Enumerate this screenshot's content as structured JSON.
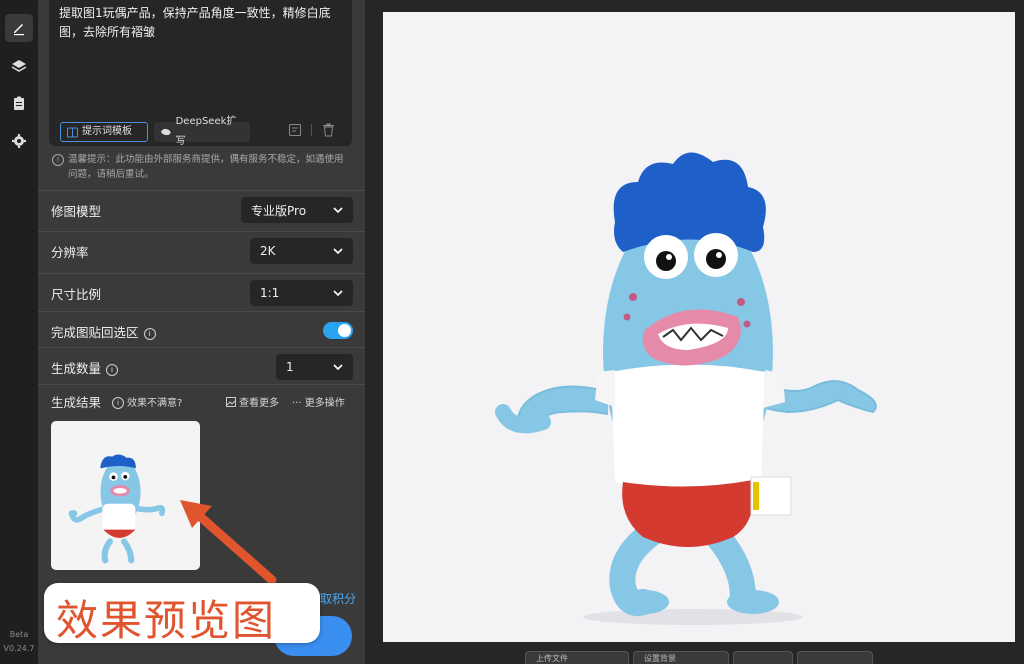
{
  "rail": {
    "items": [
      {
        "icon": "edit-icon"
      },
      {
        "icon": "layers-icon"
      },
      {
        "icon": "clipboard-icon"
      },
      {
        "icon": "gear-icon"
      }
    ],
    "beta": "Beta",
    "version": "V0.24.7"
  },
  "prompt": {
    "text": "提取图1玩偶产品，保持产品角度一致性，精修白底图，去除所有褶皱",
    "template_label": "提示词模板",
    "deepseek_label": "DeepSeek扩写"
  },
  "notice": {
    "text": "温馨提示：此功能由外部服务商提供，偶有服务不稳定，如遇使用问题，请稍后重试。"
  },
  "settings": {
    "model_label": "修图模型",
    "model_value": "专业版Pro",
    "resolution_label": "分辨率",
    "resolution_value": "2K",
    "ratio_label": "尺寸比例",
    "ratio_value": "1:1",
    "paste_back_label": "完成图贴回选区",
    "paste_back_on": true,
    "count_label": "生成数量",
    "count_value": "1"
  },
  "results": {
    "title": "生成结果",
    "unsatisfied": "效果不满意?",
    "see_more": "查看更多",
    "more_ops": "··· 更多操作"
  },
  "bottom": {
    "points_text": "取积分"
  },
  "annotation": {
    "text": "效果预览图"
  },
  "toolbar": {
    "buttons": [
      "上传文件",
      "设置背景",
      "",
      ""
    ]
  },
  "colors": {
    "accent": "#3a8ef0",
    "toggle": "#2aa3f0",
    "annotation": "#e0542e"
  }
}
